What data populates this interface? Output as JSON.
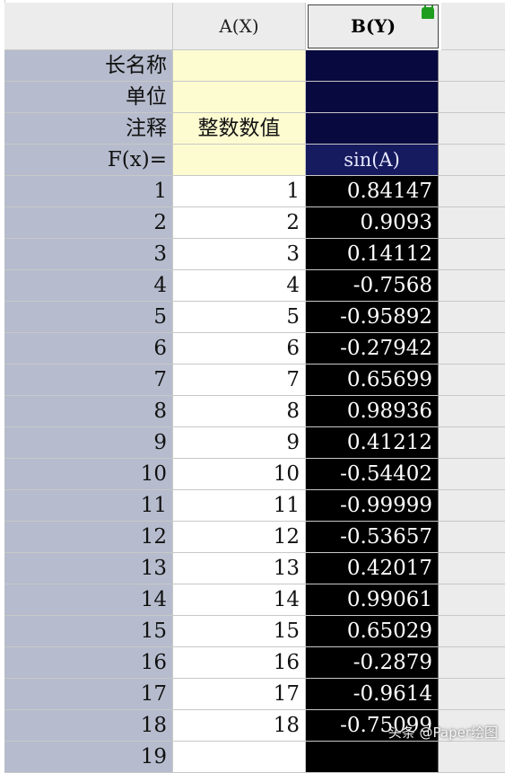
{
  "columns": {
    "a": "A(X)",
    "b": "B(Y)"
  },
  "meta_rows": {
    "long_name_label": "长名称",
    "units_label": "单位",
    "comments_label": "注释",
    "formula_label": "F(x)=",
    "a_comment": "整数数值",
    "b_formula": "sin(A)"
  },
  "rows": [
    {
      "n": "1",
      "a": "1",
      "b": "0.84147"
    },
    {
      "n": "2",
      "a": "2",
      "b": "0.9093"
    },
    {
      "n": "3",
      "a": "3",
      "b": "0.14112"
    },
    {
      "n": "4",
      "a": "4",
      "b": "-0.7568"
    },
    {
      "n": "5",
      "a": "5",
      "b": "-0.95892"
    },
    {
      "n": "6",
      "a": "6",
      "b": "-0.27942"
    },
    {
      "n": "7",
      "a": "7",
      "b": "0.65699"
    },
    {
      "n": "8",
      "a": "8",
      "b": "0.98936"
    },
    {
      "n": "9",
      "a": "9",
      "b": "0.41212"
    },
    {
      "n": "10",
      "a": "10",
      "b": "-0.54402"
    },
    {
      "n": "11",
      "a": "11",
      "b": "-0.99999"
    },
    {
      "n": "12",
      "a": "12",
      "b": "-0.53657"
    },
    {
      "n": "13",
      "a": "13",
      "b": "0.42017"
    },
    {
      "n": "14",
      "a": "14",
      "b": "0.99061"
    },
    {
      "n": "15",
      "a": "15",
      "b": "0.65029"
    },
    {
      "n": "16",
      "a": "16",
      "b": "-0.2879"
    },
    {
      "n": "17",
      "a": "17",
      "b": "-0.9614"
    },
    {
      "n": "18",
      "a": "18",
      "b": "-0.75099"
    },
    {
      "n": "19",
      "a": "",
      "b": ""
    }
  ],
  "watermark": "头条 @Paper绘图"
}
